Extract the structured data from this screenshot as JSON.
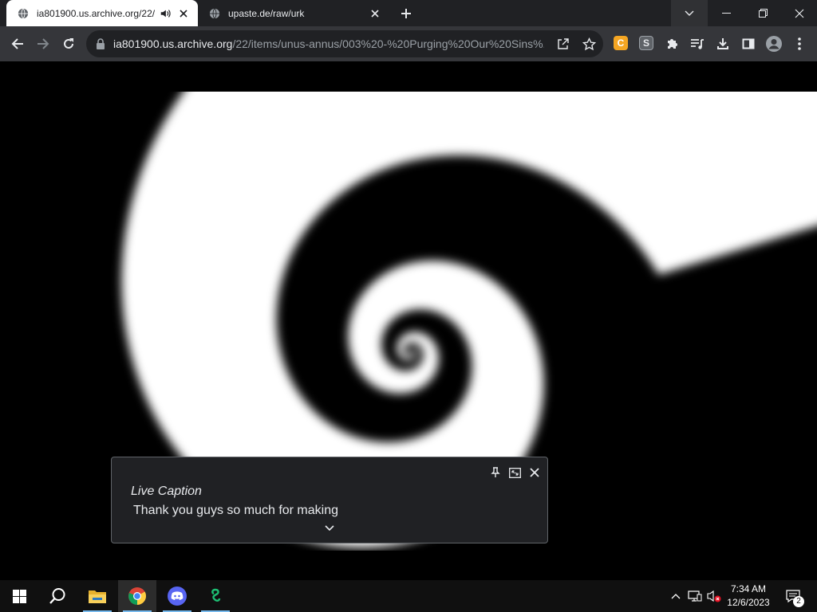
{
  "browser": {
    "tabs": [
      {
        "title": "ia801900.us.archive.org/22/",
        "active": true,
        "audio": true
      },
      {
        "title": "upaste.de/raw/urk",
        "active": false
      }
    ],
    "url": {
      "host": "ia801900.us.archive.org",
      "path": "/22/items/unus-annus/003%20-%20Purging%20Our%20Sins%..."
    },
    "extensions": [
      {
        "icon": "coupon-c-extension-icon",
        "label": "C",
        "color": "#f5a623"
      },
      {
        "icon": "s-extension-icon",
        "label": "S",
        "color": "#5f6368"
      }
    ]
  },
  "live_caption": {
    "title": "Live Caption",
    "text": "Thank you guys so much for making"
  },
  "taskbar": {
    "apps": [
      "start-button",
      "search",
      "file-explorer",
      "chrome",
      "discord",
      "app"
    ],
    "clock": {
      "time": "7:34 AM",
      "date": "12/6/2023"
    },
    "notification_count": "2"
  },
  "colors": {
    "tabstrip": "#202124",
    "toolbar": "#35363a",
    "omnibox": "#202124",
    "accent": "#76b9ed"
  }
}
